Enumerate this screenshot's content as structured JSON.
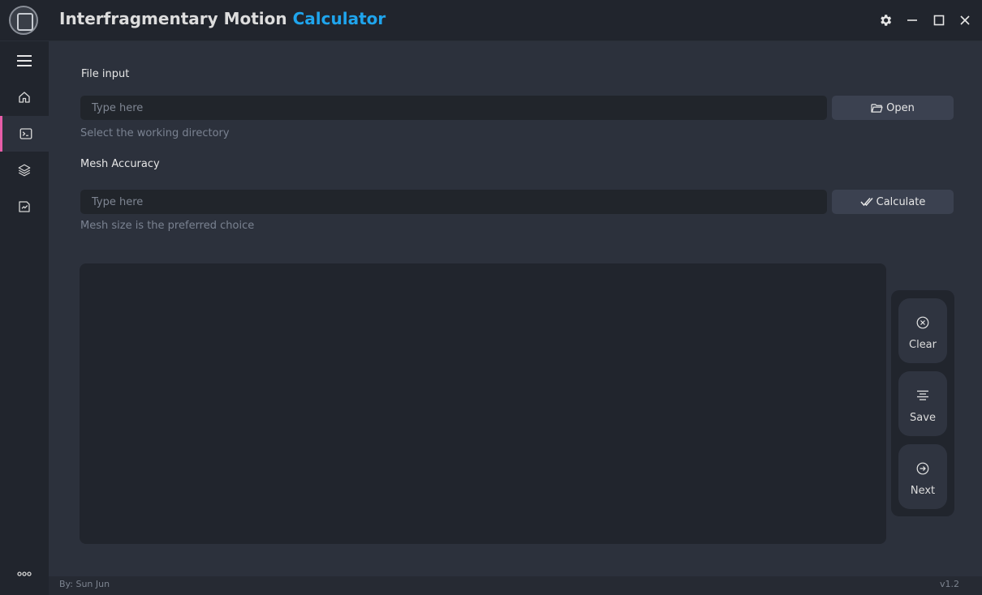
{
  "header": {
    "title_main": "Interfragmentary Motion ",
    "title_accent": "Calculator"
  },
  "sidebar": {
    "items": [
      {
        "name": "menu",
        "icon": "hamburger-menu-icon"
      },
      {
        "name": "home",
        "icon": "home-icon"
      },
      {
        "name": "terminal",
        "icon": "terminal-icon",
        "active": true
      },
      {
        "name": "layers",
        "icon": "layers-icon"
      },
      {
        "name": "save-chart",
        "icon": "save-chart-icon"
      },
      {
        "name": "more",
        "icon": "more-dots-icon"
      }
    ],
    "accent_color": "#e65da8"
  },
  "file_input": {
    "label": "File input",
    "placeholder": "Type here",
    "button_label": "Open",
    "hint": "Select the working directory"
  },
  "mesh_accuracy": {
    "label": "Mesh Accuracy",
    "placeholder": "Type here",
    "button_label": "Calculate",
    "hint": "Mesh size is the preferred choice"
  },
  "actions": {
    "clear_label": "Clear",
    "save_label": "Save",
    "next_label": "Next"
  },
  "footer": {
    "author": "By: Sun Jun",
    "version": "v1.2"
  },
  "colors": {
    "accent_blue": "#1fa5ed",
    "background": "#2c313c",
    "panel": "#21252d"
  }
}
